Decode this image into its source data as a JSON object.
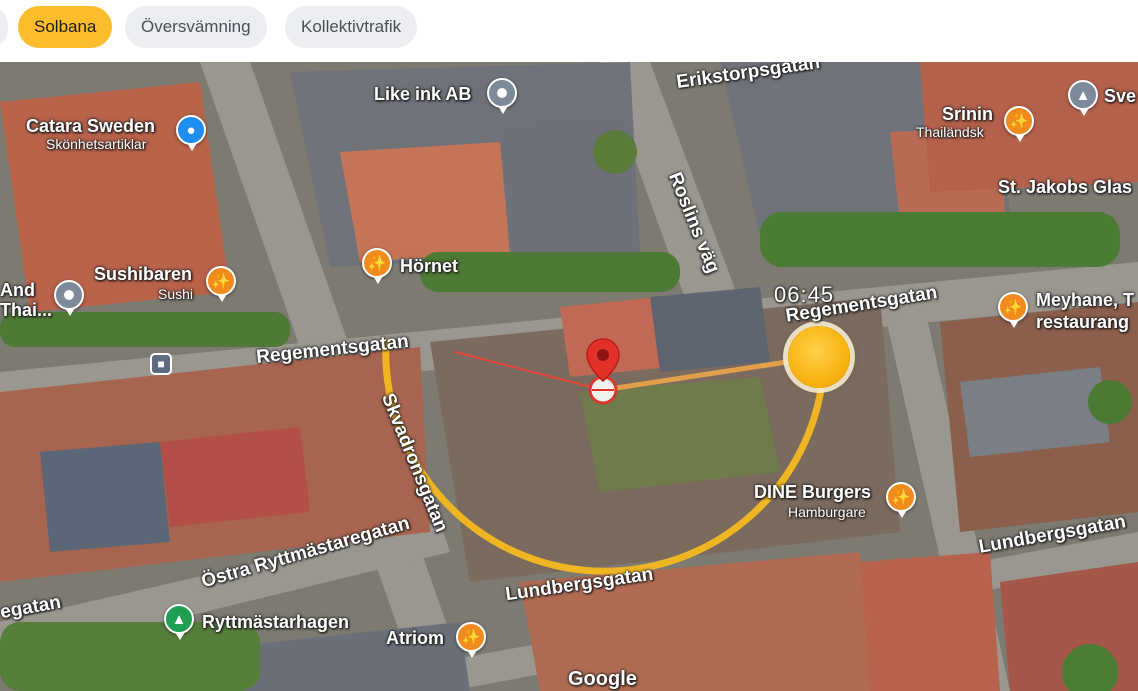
{
  "tabs": [
    {
      "label": "",
      "active": false
    },
    {
      "label": "Solbana",
      "active": true
    },
    {
      "label": "Översvämning",
      "active": false
    },
    {
      "label": "Kollektivtrafik",
      "active": false
    }
  ],
  "map": {
    "streets": {
      "regementsgatan_west": "Regementsgatan",
      "regementsgatan_east": "Regementsgatan",
      "erikstorpsgatan": "Erikstorpsgatan",
      "roslins_vag": "Roslins väg",
      "skvadronsgatan": "Skvadronsgatan",
      "ostra_ryttmastaregatan": "Östra Ryttmästaregatan",
      "lundbergsgatan_center": "Lundbergsgatan",
      "lundbergsgatan_east": "Lundbergsgatan",
      "egatan": "egatan"
    },
    "pois": {
      "catara": {
        "name": "Catara Sweden",
        "sub": "Skönhetsartiklar",
        "icon": "shopping-bag-icon"
      },
      "like_ink": {
        "name": "Like ink AB",
        "icon": "location-dot-icon"
      },
      "srinin": {
        "name": "Srinin",
        "sub": "Thailändsk",
        "icon": "restaurant-icon"
      },
      "sve": {
        "name": "Sve",
        "icon": "school-icon"
      },
      "st_jakobs": {
        "name": "St. Jakobs Glas"
      },
      "sushibaren": {
        "name": "Sushibaren",
        "sub": "Sushi",
        "icon": "restaurant-icon"
      },
      "hornet": {
        "name": "Hörnet",
        "icon": "restaurant-icon"
      },
      "and_thai": {
        "name": "And",
        "sub": "Thai...",
        "icon": "location-dot-icon"
      },
      "meyhane": {
        "name": "Meyhane, T",
        "sub": "restaurang",
        "icon": "restaurant-icon"
      },
      "dine_burgers": {
        "name": "DINE Burgers",
        "sub": "Hamburgare",
        "icon": "restaurant-icon"
      },
      "ryttmastarhagen": {
        "name": "Ryttmästarhagen",
        "icon": "tree-icon"
      },
      "atriom": {
        "name": "Atriom",
        "icon": "restaurant-icon"
      }
    },
    "sun_time": "06:45",
    "attribution": "Google",
    "colors": {
      "sun_path": "#f5b920",
      "sun_ray": "#e8463b",
      "pin": "#e3312a",
      "active_tab": "#fbbd2c"
    }
  }
}
